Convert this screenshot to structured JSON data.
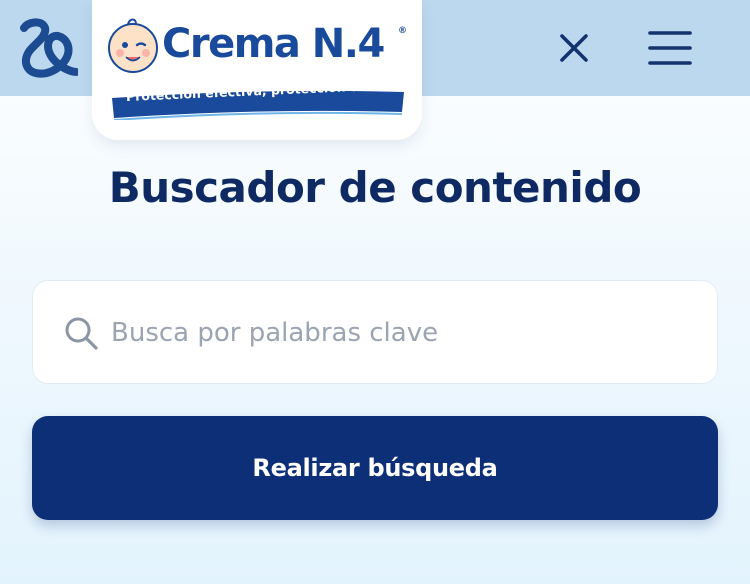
{
  "header": {
    "brand_mark_icon": "stylized-q-logo-icon",
    "logo": {
      "name": "Crema N.4",
      "registered": "®",
      "slogan": "Protección efectiva, protección de Mamá"
    },
    "close_icon": "close-icon",
    "menu_icon": "hamburger-menu-icon"
  },
  "main": {
    "title": "Buscador de contenido",
    "search": {
      "placeholder": "Busca por palabras clave",
      "value": "",
      "icon": "search-icon"
    },
    "submit_label": "Realizar búsqueda"
  },
  "colors": {
    "topbar": "#bcd8ee",
    "navy": "#0f2a63",
    "button": "#0c2f78",
    "brand_blue": "#1a4a9c"
  }
}
